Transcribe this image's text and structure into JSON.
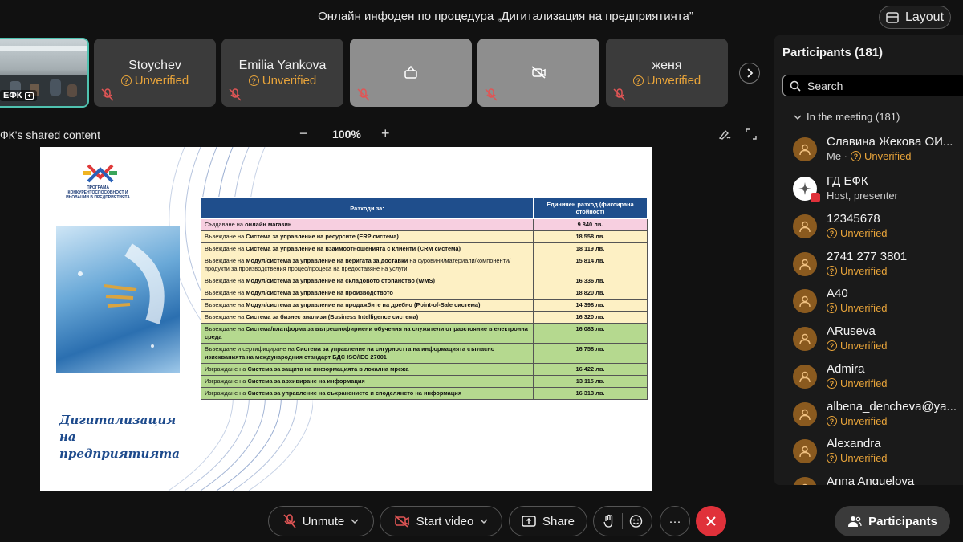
{
  "window": {
    "title": "Онлайн инфоден по процедура „Дигитализация на предприятията”",
    "layout_label": "Layout"
  },
  "video_strip": {
    "active_tile_label": "ЕФК",
    "tiles": [
      {
        "name": "Stoychev",
        "status": "Unverified"
      },
      {
        "name": "Emilia Yankova",
        "status": "Unverified"
      },
      {
        "name": "",
        "status": ""
      },
      {
        "name": "",
        "status": ""
      },
      {
        "name": "женя",
        "status": "Unverified"
      }
    ]
  },
  "share": {
    "label": "ФК's shared content",
    "zoom": "100%",
    "zoom_minus": "−",
    "zoom_plus": "+"
  },
  "slide": {
    "logo_text": "ПРОГРАМА КОНКУРЕНТОСПОСОБНОСТ И ИНОВАЦИИ В ПРЕДПРИЯТИЯТА",
    "caption": "Дигитализация на предприятията",
    "table": {
      "header_col1": "Разходи за:",
      "header_col2": "Единичен разход (фиксирана стойност)",
      "rows": [
        {
          "pre": "Създаване на ",
          "bold": "онлайн магазин",
          "post": "",
          "value": "9 840 лв.",
          "color": "pink"
        },
        {
          "pre": "Въвеждане на ",
          "bold": "Система за управление на ресурсите (ERP система)",
          "post": "",
          "value": "18 558 лв.",
          "color": "yellow"
        },
        {
          "pre": "Въвеждане на ",
          "bold": "Система за управление на взаимоотношенията с клиенти (CRM система)",
          "post": "",
          "value": "18 119 лв.",
          "color": "yellow"
        },
        {
          "pre": "Въвеждане на ",
          "bold": "Модул/система за управление на веригата за доставки",
          "post": " на суровини/материали/компоненти/продукти за производствения процес/процеса на предоставяне на услуги",
          "value": "15 814 лв.",
          "color": "yellow"
        },
        {
          "pre": "Въвеждане на ",
          "bold": "Модул/система за управление на складовото стопанство (WMS)",
          "post": "",
          "value": "16 336 лв.",
          "color": "yellow"
        },
        {
          "pre": "Въвеждане на ",
          "bold": "Модул/система за управление на производството",
          "post": "",
          "value": "18 820 лв.",
          "color": "yellow"
        },
        {
          "pre": "Въвеждане на ",
          "bold": "Модул/система за управление на продажбите на дребно (Point-of-Sale система)",
          "post": "",
          "value": "14 398 лв.",
          "color": "yellow"
        },
        {
          "pre": "Въвеждане на ",
          "bold": "Система за бизнес анализи (Business Intelligence система)",
          "post": "",
          "value": "16 320 лв.",
          "color": "yellow"
        },
        {
          "pre": "Въвеждане на ",
          "bold": "Система/платформа за вътрешнофирмени обучения на служители от разстояние в електронна среда",
          "post": "",
          "value": "16 083 лв.",
          "color": "green"
        },
        {
          "pre": "Въвеждане и сертифициране на ",
          "bold": "Система за управление на сигурността на информацията съгласно изискванията на международния стандарт БДС ISO/IEC 27001",
          "post": "",
          "value": "16 758 лв.",
          "color": "green"
        },
        {
          "pre": "Изграждане на ",
          "bold": "Система за защита на информацията в локална мрежа",
          "post": "",
          "value": "16 422 лв.",
          "color": "green"
        },
        {
          "pre": "Изграждане на ",
          "bold": "Система за архивиране на информация",
          "post": "",
          "value": "13 115 лв.",
          "color": "green"
        },
        {
          "pre": "Изграждане на ",
          "bold": "Система за управление на съхранението и споделянето на информация",
          "post": "",
          "value": "16 313 лв.",
          "color": "green"
        }
      ]
    }
  },
  "participants_panel": {
    "title": "Participants (181)",
    "search_placeholder": "Search",
    "section": "In the meeting (181)",
    "items": [
      {
        "name": "Славина Жекова ОИ...",
        "sub_prefix": "Me · ",
        "sub": "Unverified",
        "host": false
      },
      {
        "name": "ГД ЕФК",
        "sub_prefix": "Host, presenter",
        "sub": "",
        "host": true
      },
      {
        "name": "12345678",
        "sub_prefix": "",
        "sub": "Unverified",
        "host": false
      },
      {
        "name": "2741 277 3801",
        "sub_prefix": "",
        "sub": "Unverified",
        "host": false
      },
      {
        "name": "A40",
        "sub_prefix": "",
        "sub": "Unverified",
        "host": false
      },
      {
        "name": "ARuseva",
        "sub_prefix": "",
        "sub": "Unverified",
        "host": false
      },
      {
        "name": "Admira",
        "sub_prefix": "",
        "sub": "Unverified",
        "host": false
      },
      {
        "name": "albena_dencheva@ya...",
        "sub_prefix": "",
        "sub": "Unverified",
        "host": false
      },
      {
        "name": "Alexandra",
        "sub_prefix": "",
        "sub": "Unverified",
        "host": false
      },
      {
        "name": "Anna Anguelova",
        "sub_prefix": "",
        "sub": "",
        "host": false
      }
    ]
  },
  "controls": {
    "unmute": "Unmute",
    "start_video": "Start video",
    "share": "Share",
    "participants": "Participants",
    "more": "···"
  },
  "colors": {
    "unverified": "#e8a43a",
    "end_call": "#e0313a",
    "active_tile_border": "#4fc2b0",
    "table_header": "#1f4e8c"
  }
}
